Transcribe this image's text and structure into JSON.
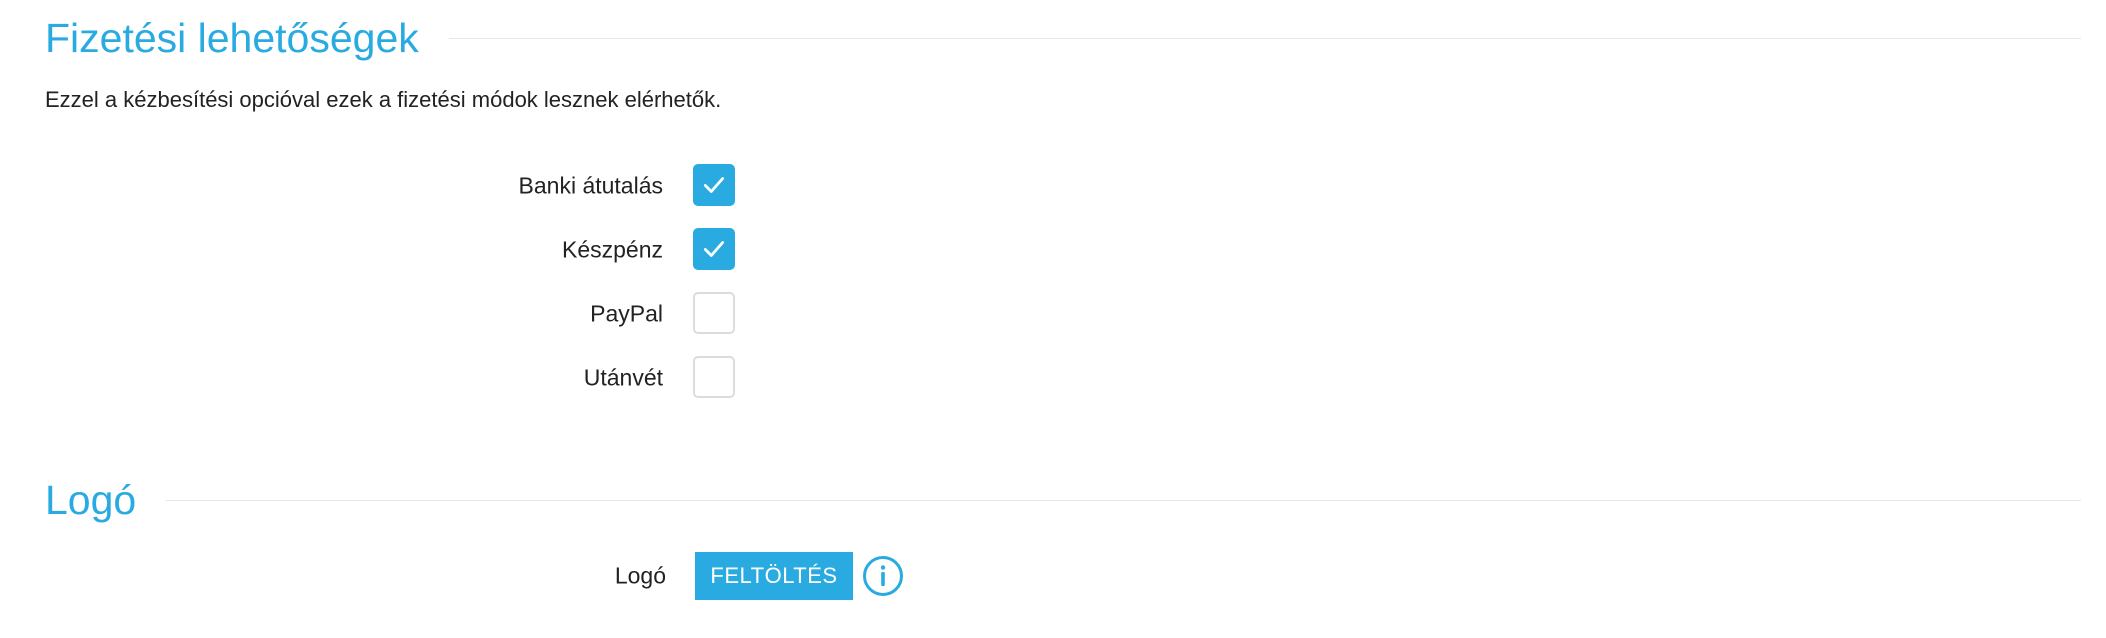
{
  "payment_section": {
    "title": "Fizetési lehetőségek",
    "description": "Ezzel a kézbesítési opcióval ezek a fizetési módok lesznek elérhetők.",
    "options": [
      {
        "label": "Banki átutalás",
        "checked": true
      },
      {
        "label": "Készpénz",
        "checked": true
      },
      {
        "label": "PayPal",
        "checked": false
      },
      {
        "label": "Utánvét",
        "checked": false
      }
    ]
  },
  "logo_section": {
    "title": "Logó",
    "field_label": "Logó",
    "upload_label": "FELTÖLTÉS",
    "info_icon": "info-icon"
  },
  "colors": {
    "accent": "#29abe2",
    "text": "#222222",
    "rule": "#e6e6e6",
    "checkbox_border": "#dcdcdc"
  }
}
